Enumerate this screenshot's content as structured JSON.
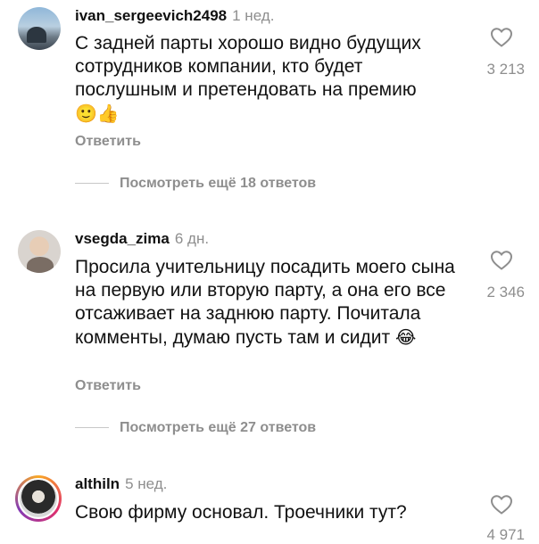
{
  "comments": [
    {
      "username": "ivan_sergeevich2498",
      "time": "1 нед.",
      "text": "С задней парты хорошо видно будущих сотрудников компании, кто будет послушным и претендовать на премию",
      "emojis": "🙂👍",
      "reply_label": "Ответить",
      "view_replies": "Посмотреть ещё 18 ответов",
      "likes": "3 213"
    },
    {
      "username": "vsegda_zima",
      "time": "6 дн.",
      "text": "Просила учительницу посадить моего сына на первую или вторую парту, а она его все отсаживает на заднюю парту. Почитала комменты, думаю пусть там и сидит",
      "emojis": "😂",
      "reply_label": "Ответить",
      "view_replies": "Посмотреть ещё 27 ответов",
      "likes": "2 346"
    },
    {
      "username": "althiln",
      "time": "5 нед.",
      "text": "Свою фирму основал. Троечники тут?",
      "likes": "4 971"
    }
  ],
  "icons": {
    "like": "heart-outline-icon"
  }
}
